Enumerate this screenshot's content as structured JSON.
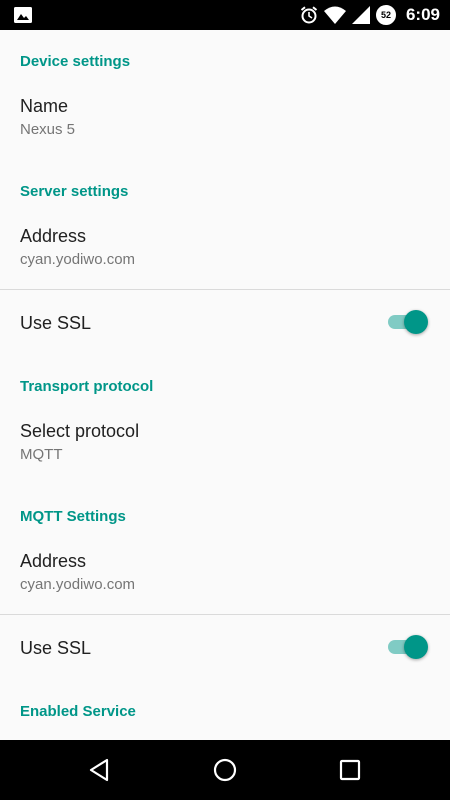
{
  "status_bar": {
    "time": "6:09",
    "battery_level": "52",
    "icons": [
      "photo-icon",
      "alarm-icon",
      "wifi-icon",
      "signal-icon",
      "battery-icon"
    ]
  },
  "sections": {
    "device": {
      "header": "Device settings",
      "name_title": "Name",
      "name_value": "Nexus 5"
    },
    "server": {
      "header": "Server settings",
      "address_title": "Address",
      "address_value": "cyan.yodiwo.com",
      "ssl_title": "Use SSL",
      "ssl_enabled": true
    },
    "transport": {
      "header": "Transport protocol",
      "protocol_title": "Select protocol",
      "protocol_value": "MQTT"
    },
    "mqtt": {
      "header": "MQTT Settings",
      "address_title": "Address",
      "address_value": "cyan.yodiwo.com",
      "ssl_title": "Use SSL",
      "ssl_enabled": true
    },
    "enabled_service": {
      "header": "Enabled Service"
    }
  },
  "nav_bar": {
    "icons": [
      "back-icon",
      "home-icon",
      "recents-icon"
    ]
  },
  "colors": {
    "accent": "#009688",
    "switch_track": "#80cbc4",
    "background": "#fafafa",
    "title_text": "#212121",
    "summary_text": "#757575"
  }
}
